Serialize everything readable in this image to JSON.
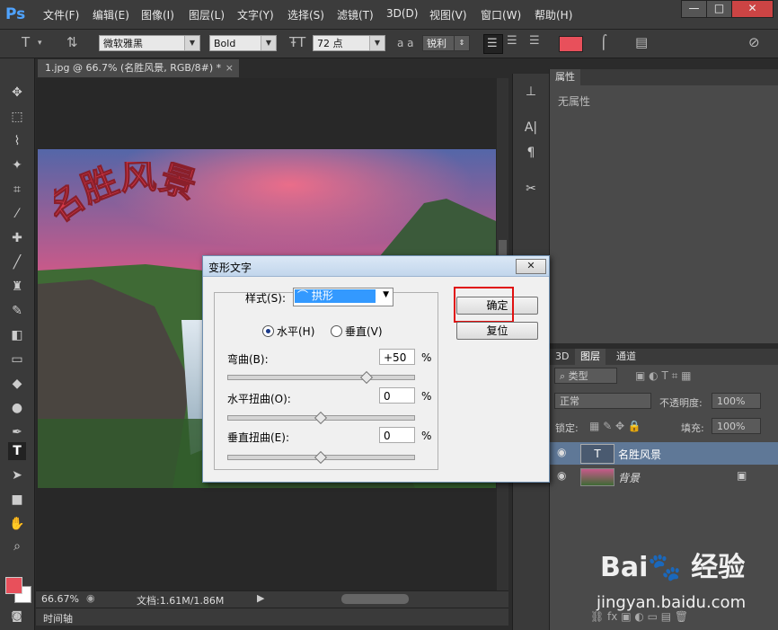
{
  "app": {
    "logo": "Ps",
    "menu": [
      "文件(F)",
      "编辑(E)",
      "图像(I)",
      "图层(L)",
      "文字(Y)",
      "选择(S)",
      "滤镜(T)",
      "3D(D)",
      "视图(V)",
      "窗口(W)",
      "帮助(H)"
    ],
    "window_buttons": [
      "—",
      "□",
      "✕"
    ]
  },
  "options": {
    "font_family": "微软雅黑",
    "font_style": "Bold",
    "font_size": "72 点",
    "aa_label": "a a",
    "antialias": "锐利",
    "text_color": "#e8505b"
  },
  "document": {
    "tab_title": "1.jpg @ 66.7% (名胜风景, RGB/8#) *",
    "warped_text": "名胜风景",
    "zoom": "66.67%",
    "doc_info": "文档:1.61M/1.86M",
    "timeline": "时间轴"
  },
  "properties": {
    "tab": "属性",
    "empty": "无属性"
  },
  "layers": {
    "tabs": [
      "3D",
      "图层",
      "通道"
    ],
    "filter": "类型",
    "blend": "正常",
    "opacity_label": "不透明度:",
    "opacity": "100%",
    "lock_label": "锁定:",
    "fill_label": "填充:",
    "fill": "100%",
    "items": [
      {
        "name": "名胜风景",
        "type": "text"
      },
      {
        "name": "背景",
        "type": "image"
      }
    ]
  },
  "dialog": {
    "title": "变形文字",
    "style_label": "样式(S):",
    "style_value": "拱形",
    "horizontal": "水平(H)",
    "vertical": "垂直(V)",
    "orientation": "horizontal",
    "bend_label": "弯曲(B):",
    "bend": "+50",
    "bend_fraction": 0.75,
    "hdist_label": "水平扭曲(O):",
    "hdist": "0",
    "hdist_fraction": 0.5,
    "vdist_label": "垂直扭曲(E):",
    "vdist": "0",
    "vdist_fraction": 0.5,
    "percent": "%",
    "ok": "确定",
    "reset": "复位"
  },
  "colors": {
    "foreground": "#e8505b",
    "background": "#ffffff",
    "highlight_box": "#e01010"
  },
  "watermark": {
    "brand": "Bai 经验",
    "url": "jingyan.baidu.com"
  }
}
